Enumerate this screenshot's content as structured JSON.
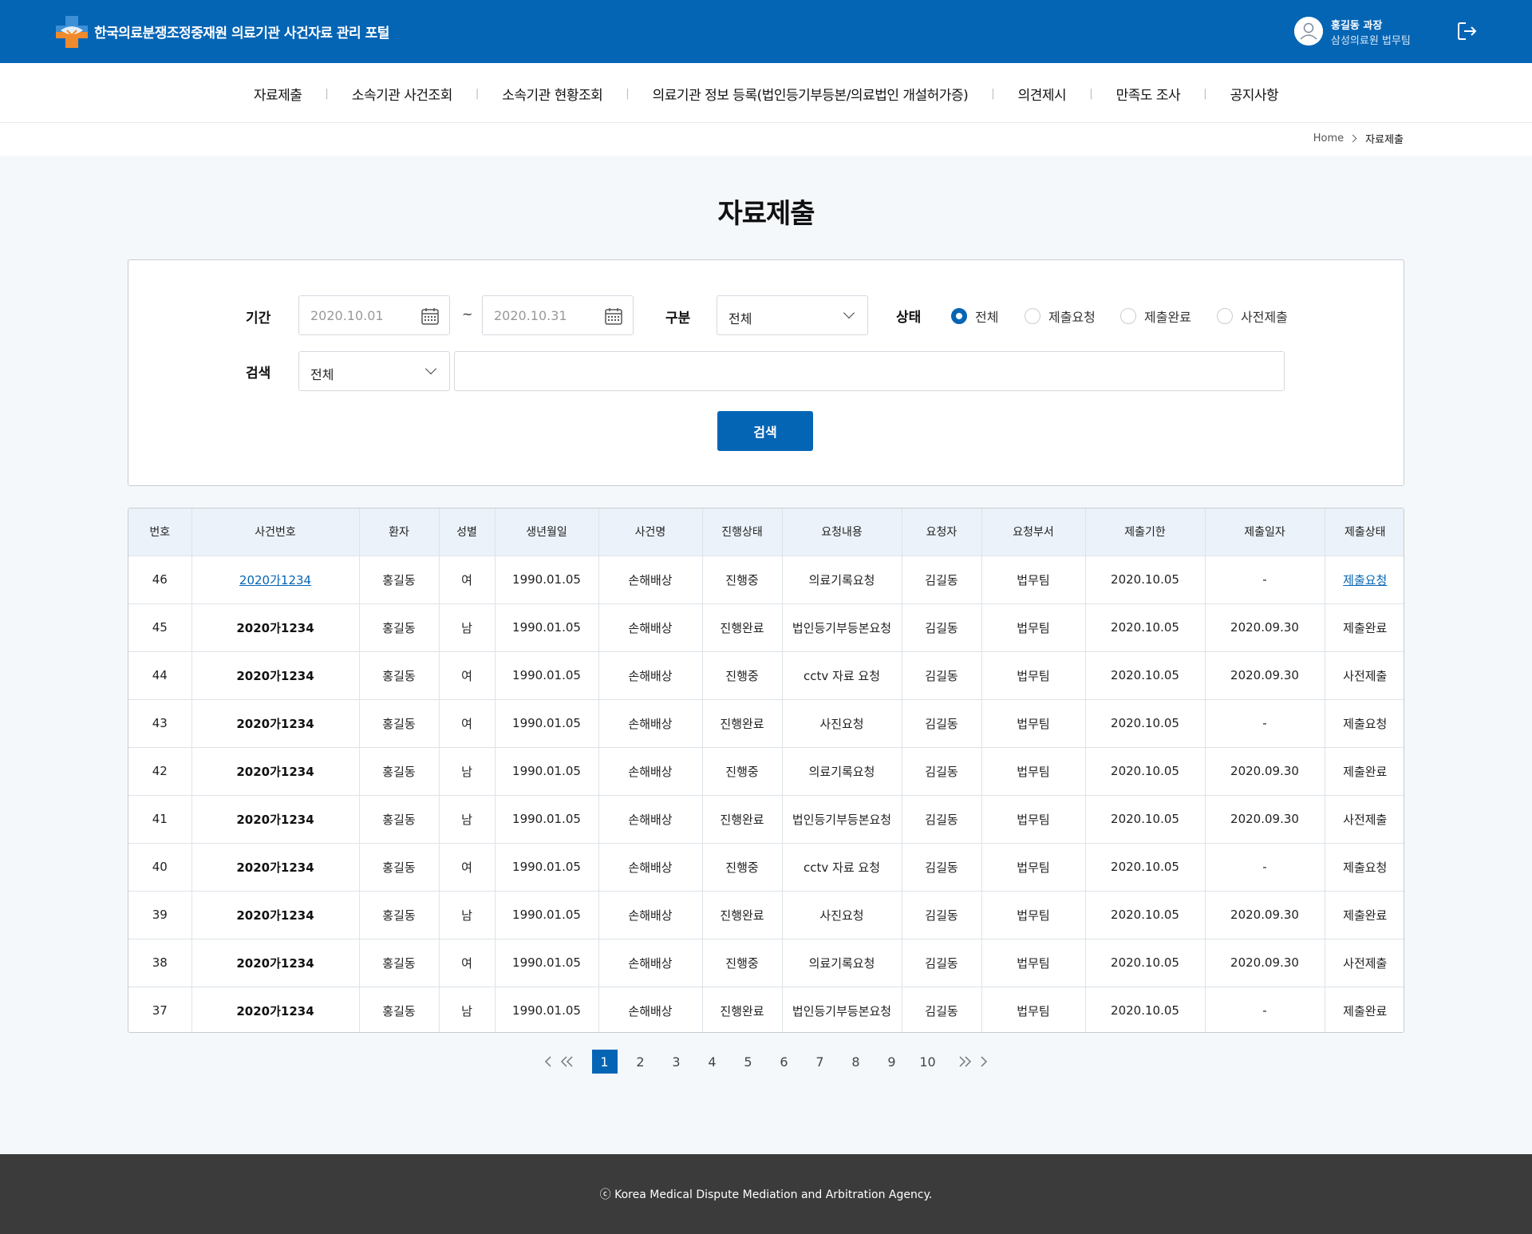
{
  "header": {
    "title": "한국의료분쟁조정중재원 의료기관 사건자료 관리 포털",
    "user_name": "홍길동 과장",
    "user_org": "삼성의료원 법무팀"
  },
  "nav": [
    "자료제출",
    "소속기관 사건조회",
    "소속기관 현황조회",
    "의료기관 정보 등록(법인등기부등본/의료법인 개설허가증)",
    "의견제시",
    "만족도 조사",
    "공지사항"
  ],
  "breadcrumb": {
    "home": "Home",
    "current": "자료제출"
  },
  "page_title": "자료제출",
  "search": {
    "period_label": "기간",
    "date_from": "2020.10.01",
    "date_to": "2020.10.31",
    "tilde": "~",
    "category_label": "구분",
    "category_value": "전체",
    "status_label": "상태",
    "status_options": [
      "전체",
      "제출요청",
      "제출완료",
      "사전제출"
    ],
    "status_selected": "전체",
    "keyword_label": "검색",
    "keyword_scope": "전체",
    "keyword_value": "",
    "button": "검색"
  },
  "table": {
    "headers": [
      "번호",
      "사건번호",
      "환자",
      "성별",
      "생년월일",
      "사건명",
      "진행상태",
      "요청내용",
      "요청자",
      "요청부서",
      "제출기한",
      "제출일자",
      "제출상태"
    ],
    "rows": [
      [
        "46",
        "2020가1234",
        "홍길동",
        "여",
        "1990.01.05",
        "손해배상",
        "진행중",
        "의료기록요청",
        "김길동",
        "법무팀",
        "2020.10.05",
        "-",
        "제출요청"
      ],
      [
        "45",
        "2020가1234",
        "홍길동",
        "남",
        "1990.01.05",
        "손해배상",
        "진행완료",
        "법인등기부등본요청",
        "김길동",
        "법무팀",
        "2020.10.05",
        "2020.09.30",
        "제출완료"
      ],
      [
        "44",
        "2020가1234",
        "홍길동",
        "여",
        "1990.01.05",
        "손해배상",
        "진행중",
        "cctv 자료 요청",
        "김길동",
        "법무팀",
        "2020.10.05",
        "2020.09.30",
        "사전제출"
      ],
      [
        "43",
        "2020가1234",
        "홍길동",
        "여",
        "1990.01.05",
        "손해배상",
        "진행완료",
        "사진요청",
        "김길동",
        "법무팀",
        "2020.10.05",
        "-",
        "제출요청"
      ],
      [
        "42",
        "2020가1234",
        "홍길동",
        "남",
        "1990.01.05",
        "손해배상",
        "진행중",
        "의료기록요청",
        "김길동",
        "법무팀",
        "2020.10.05",
        "2020.09.30",
        "제출완료"
      ],
      [
        "41",
        "2020가1234",
        "홍길동",
        "남",
        "1990.01.05",
        "손해배상",
        "진행완료",
        "법인등기부등본요청",
        "김길동",
        "법무팀",
        "2020.10.05",
        "2020.09.30",
        "사전제출"
      ],
      [
        "40",
        "2020가1234",
        "홍길동",
        "여",
        "1990.01.05",
        "손해배상",
        "진행중",
        "cctv 자료 요청",
        "김길동",
        "법무팀",
        "2020.10.05",
        "-",
        "제출요청"
      ],
      [
        "39",
        "2020가1234",
        "홍길동",
        "남",
        "1990.01.05",
        "손해배상",
        "진행완료",
        "사진요청",
        "김길동",
        "법무팀",
        "2020.10.05",
        "2020.09.30",
        "제출완료"
      ],
      [
        "38",
        "2020가1234",
        "홍길동",
        "여",
        "1990.01.05",
        "손해배상",
        "진행중",
        "의료기록요청",
        "김길동",
        "법무팀",
        "2020.10.05",
        "2020.09.30",
        "사전제출"
      ],
      [
        "37",
        "2020가1234",
        "홍길동",
        "남",
        "1990.01.05",
        "손해배상",
        "진행완료",
        "법인등기부등본요청",
        "김길동",
        "법무팀",
        "2020.10.05",
        "-",
        "제출완료"
      ]
    ]
  },
  "pagination": {
    "pages": [
      "1",
      "2",
      "3",
      "4",
      "5",
      "6",
      "7",
      "8",
      "9",
      "10"
    ],
    "current": "1"
  },
  "footer": "ⓒ Korea Medical Dispute Mediation and Arbitration Agency.",
  "colors": {
    "primary": "#0565b5",
    "footer_bg": "#3b3b3b",
    "page_bg": "#f4f8fb",
    "table_header_bg": "#ebf2f9"
  }
}
